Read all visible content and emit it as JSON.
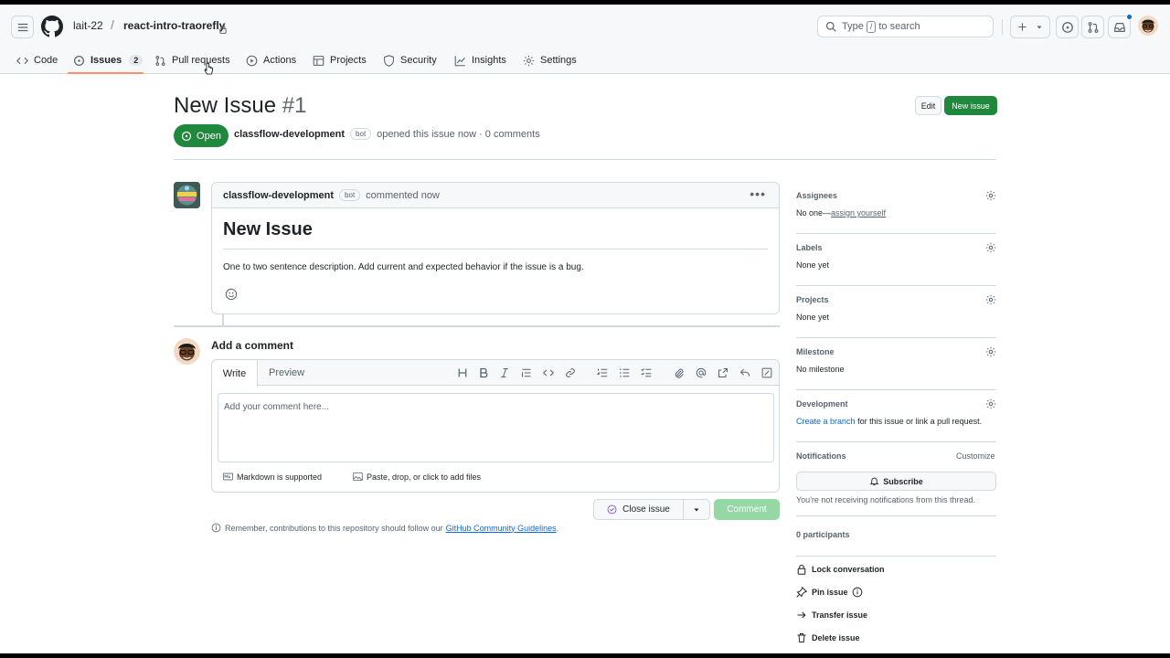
{
  "header": {
    "owner": "lait-22",
    "separator": "/",
    "repo": "react-intro-traorefly",
    "search_pre": "Type",
    "search_key": "/",
    "search_post": "to search"
  },
  "tabs": [
    {
      "label": "Code"
    },
    {
      "label": "Issues",
      "count": "2"
    },
    {
      "label": "Pull requests"
    },
    {
      "label": "Actions"
    },
    {
      "label": "Projects"
    },
    {
      "label": "Security"
    },
    {
      "label": "Insights"
    },
    {
      "label": "Settings"
    }
  ],
  "issue": {
    "title": "New Issue",
    "number": "#1",
    "edit_label": "Edit",
    "new_label": "New issue",
    "state": "Open",
    "author": "classflow-development",
    "bot_badge": "bot",
    "opened_text": "opened this issue now · 0 comments"
  },
  "comment": {
    "author": "classflow-development",
    "bot_badge": "bot",
    "time": "commented now",
    "heading": "New Issue",
    "body": "One to two sentence description. Add current and expected behavior if the issue is a bug."
  },
  "composer": {
    "title": "Add a comment",
    "tab_write": "Write",
    "tab_preview": "Preview",
    "placeholder": "Add your comment here...",
    "markdown": "Markdown is supported",
    "attach": "Paste, drop, or click to add files",
    "close_label": "Close issue",
    "comment_label": "Comment",
    "remember": "Remember, contributions to this repository should follow our",
    "guidelines": "GitHub Community Guidelines",
    "period": "."
  },
  "sidebar": {
    "assignees_h": "Assignees",
    "assignees_v": "No one—",
    "assign_link": "assign yourself",
    "labels_h": "Labels",
    "labels_v": "None yet",
    "projects_h": "Projects",
    "projects_v": "None yet",
    "milestone_h": "Milestone",
    "milestone_v": "No milestone",
    "development_h": "Development",
    "dev_link": "Create a branch",
    "dev_rest": "for this issue or link a pull request.",
    "notifications_h": "Notifications",
    "customize": "Customize",
    "subscribe": "Subscribe",
    "notif_note": "You're not receiving notifications from this thread.",
    "participants": "0 participants",
    "lock": "Lock conversation",
    "pin": "Pin issue",
    "transfer": "Transfer issue",
    "delete": "Delete issue"
  },
  "colors": {
    "green": "#1f883d",
    "underline": "#fd8c73",
    "link": "#0969da"
  }
}
